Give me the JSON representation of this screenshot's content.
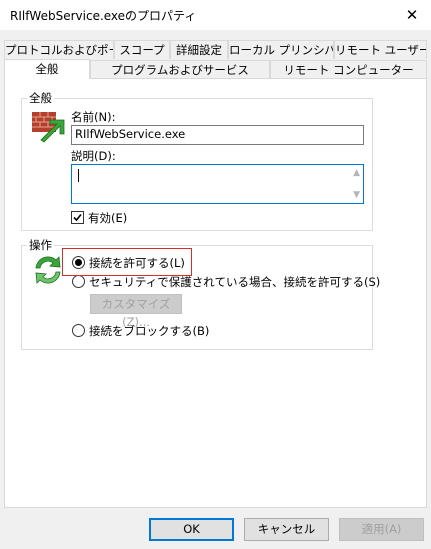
{
  "window": {
    "title": "RIlfWebService.exeのプロパティ",
    "close_glyph": "✕"
  },
  "tabs_row1": [
    {
      "label": "プロトコルおよびポート"
    },
    {
      "label": "スコープ"
    },
    {
      "label": "詳細設定"
    },
    {
      "label": "ローカル プリンシパル"
    },
    {
      "label": "リモート ユーザー"
    }
  ],
  "tabs_row2": [
    {
      "label": "全般",
      "selected": true
    },
    {
      "label": "プログラムおよびサービス"
    },
    {
      "label": "リモート コンピューター"
    }
  ],
  "general_group": {
    "label": "全般",
    "name_label": "名前(N):",
    "name_value": "RIlfWebService.exe",
    "description_label": "説明(D):",
    "description_value": "",
    "enabled_label": "有効(E)",
    "enabled_checked": true,
    "icon": "firewall-rule-icon"
  },
  "action_group": {
    "label": "操作",
    "icon": "sync-arrows-icon",
    "options": [
      {
        "label": "接続を許可する(L)",
        "selected": true
      },
      {
        "label": "セキュリティで保護されている場合、接続を許可する(S)",
        "selected": false
      },
      {
        "label": "接続をブロックする(B)",
        "selected": false
      }
    ],
    "customize_button": "カスタマイズ(Z)...",
    "highlight_color": "#d32f2f"
  },
  "footer": {
    "ok": "OK",
    "cancel": "キャンセル",
    "apply": "適用(A)"
  },
  "colors": {
    "accent": "#0078d7",
    "dialog_bg": "#f0f0f0",
    "icon_green": "#3aa63a",
    "icon_brick": "#b3402c"
  }
}
